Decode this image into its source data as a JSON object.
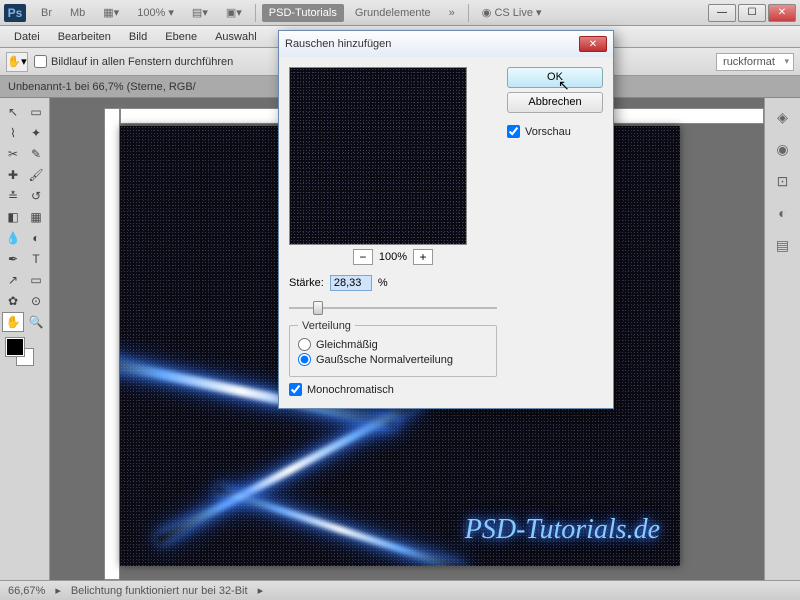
{
  "titlebar": {
    "logo": "Ps",
    "br": "Br",
    "mb": "Mb",
    "zoom": "100%",
    "tab1": "PSD-Tutorials",
    "tab2": "Grundelemente",
    "more": "»",
    "cslive": "CS Live"
  },
  "menu": [
    "Datei",
    "Bearbeiten",
    "Bild",
    "Ebene",
    "Auswahl"
  ],
  "options": {
    "scrollAll": "Bildlauf in allen Fenstern durchführen",
    "printFormat": "ruckformat"
  },
  "docTab": "Unbenannt-1 bei 66,7% (Sterne, RGB/",
  "watermark": "PSD-Tutorials.de",
  "status": {
    "zoom": "66,67%",
    "msg": "Belichtung funktioniert nur bei 32-Bit"
  },
  "dialog": {
    "title": "Rauschen hinzufügen",
    "ok": "OK",
    "cancel": "Abbrechen",
    "preview": "Vorschau",
    "zoom": "100%",
    "amountLabel": "Stärke:",
    "amountValue": "28,33",
    "amountUnit": "%",
    "distLegend": "Verteilung",
    "distUniform": "Gleichmäßig",
    "distGaussian": "Gaußsche Normalverteilung",
    "mono": "Monochromatisch"
  }
}
